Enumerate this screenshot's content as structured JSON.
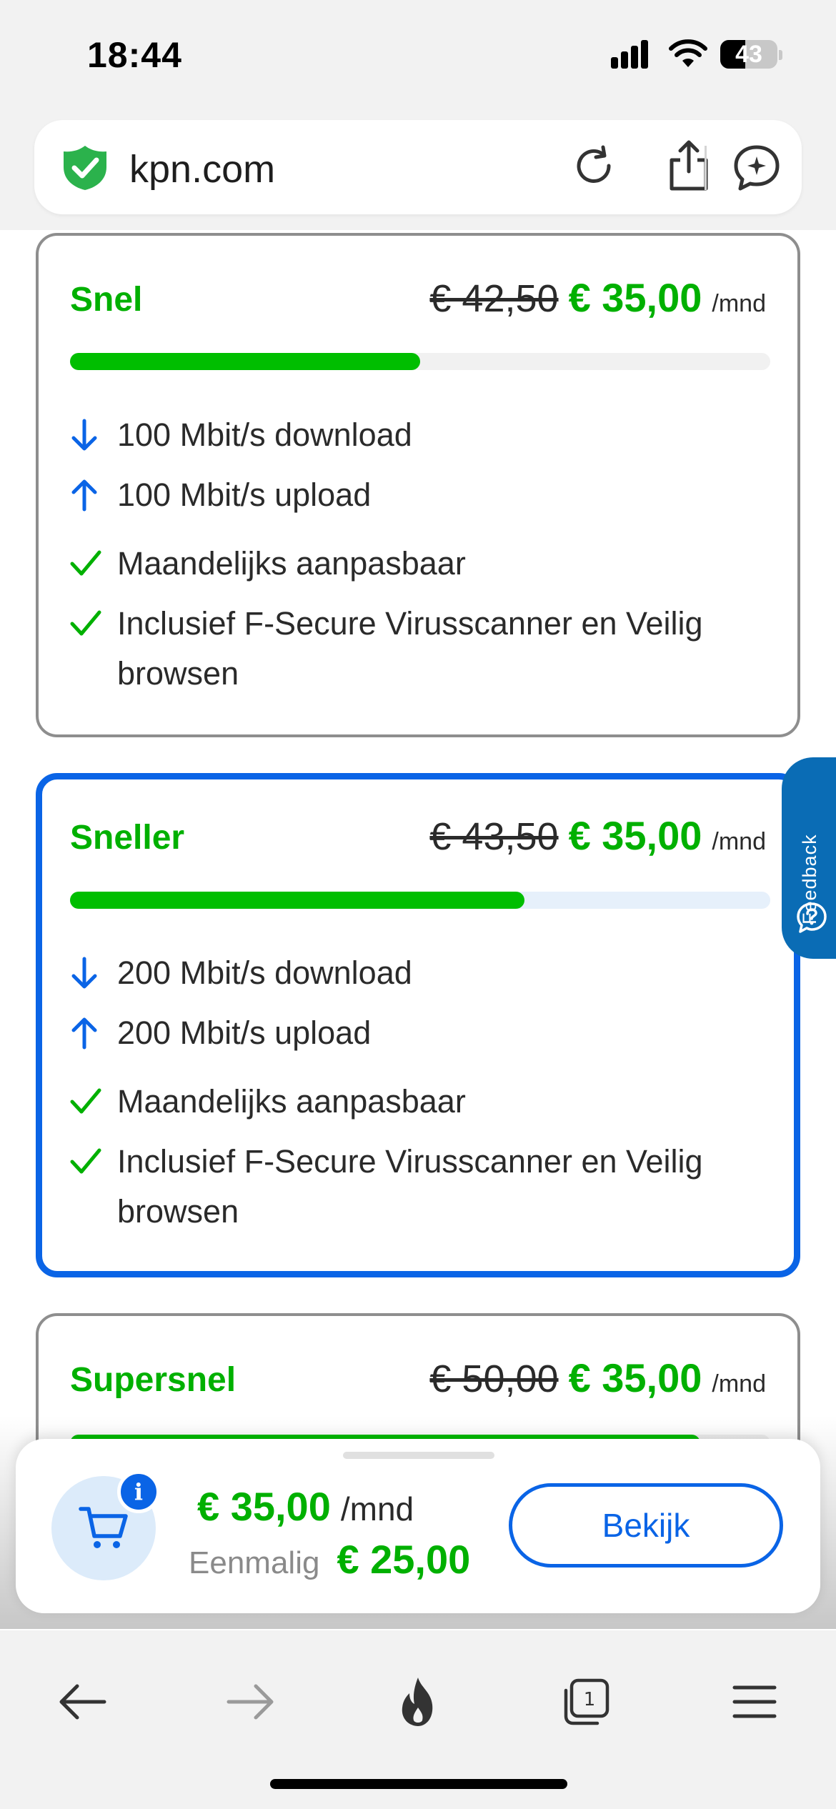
{
  "status_bar": {
    "time": "18:44",
    "battery": "43"
  },
  "address_bar": {
    "url": "kpn.com"
  },
  "plans": [
    {
      "name": "Snel",
      "old_price": "€ 42,50",
      "new_price": "€ 35,00",
      "per": "/mnd",
      "speed_fraction": 0.5,
      "selected": false,
      "features": [
        "100 Mbit/s download",
        "100 Mbit/s upload",
        "Maandelijks aanpasbaar",
        "Inclusief F-Secure Virusscanner en Veilig browsen"
      ]
    },
    {
      "name": "Sneller",
      "old_price": "€ 43,50",
      "new_price": "€ 35,00",
      "per": "/mnd",
      "speed_fraction": 0.65,
      "selected": true,
      "features": [
        "200 Mbit/s download",
        "200 Mbit/s upload",
        "Maandelijks aanpasbaar",
        "Inclusief F-Secure Virusscanner en Veilig browsen"
      ]
    },
    {
      "name": "Supersnel",
      "old_price": "€ 50,00",
      "new_price": "€ 35,00",
      "per": "/mnd",
      "speed_fraction": 0.9,
      "selected": false,
      "features": []
    }
  ],
  "feedback": {
    "label": "Feedback"
  },
  "cart": {
    "badge": "i",
    "monthly_price": "€ 35,00",
    "per": "/mnd",
    "one_time_label": "Eenmalig",
    "one_time_price": "€ 25,00",
    "button_label": "Bekijk"
  },
  "colors": {
    "brand_green": "#00b000",
    "accent_blue": "#0a64e6"
  }
}
